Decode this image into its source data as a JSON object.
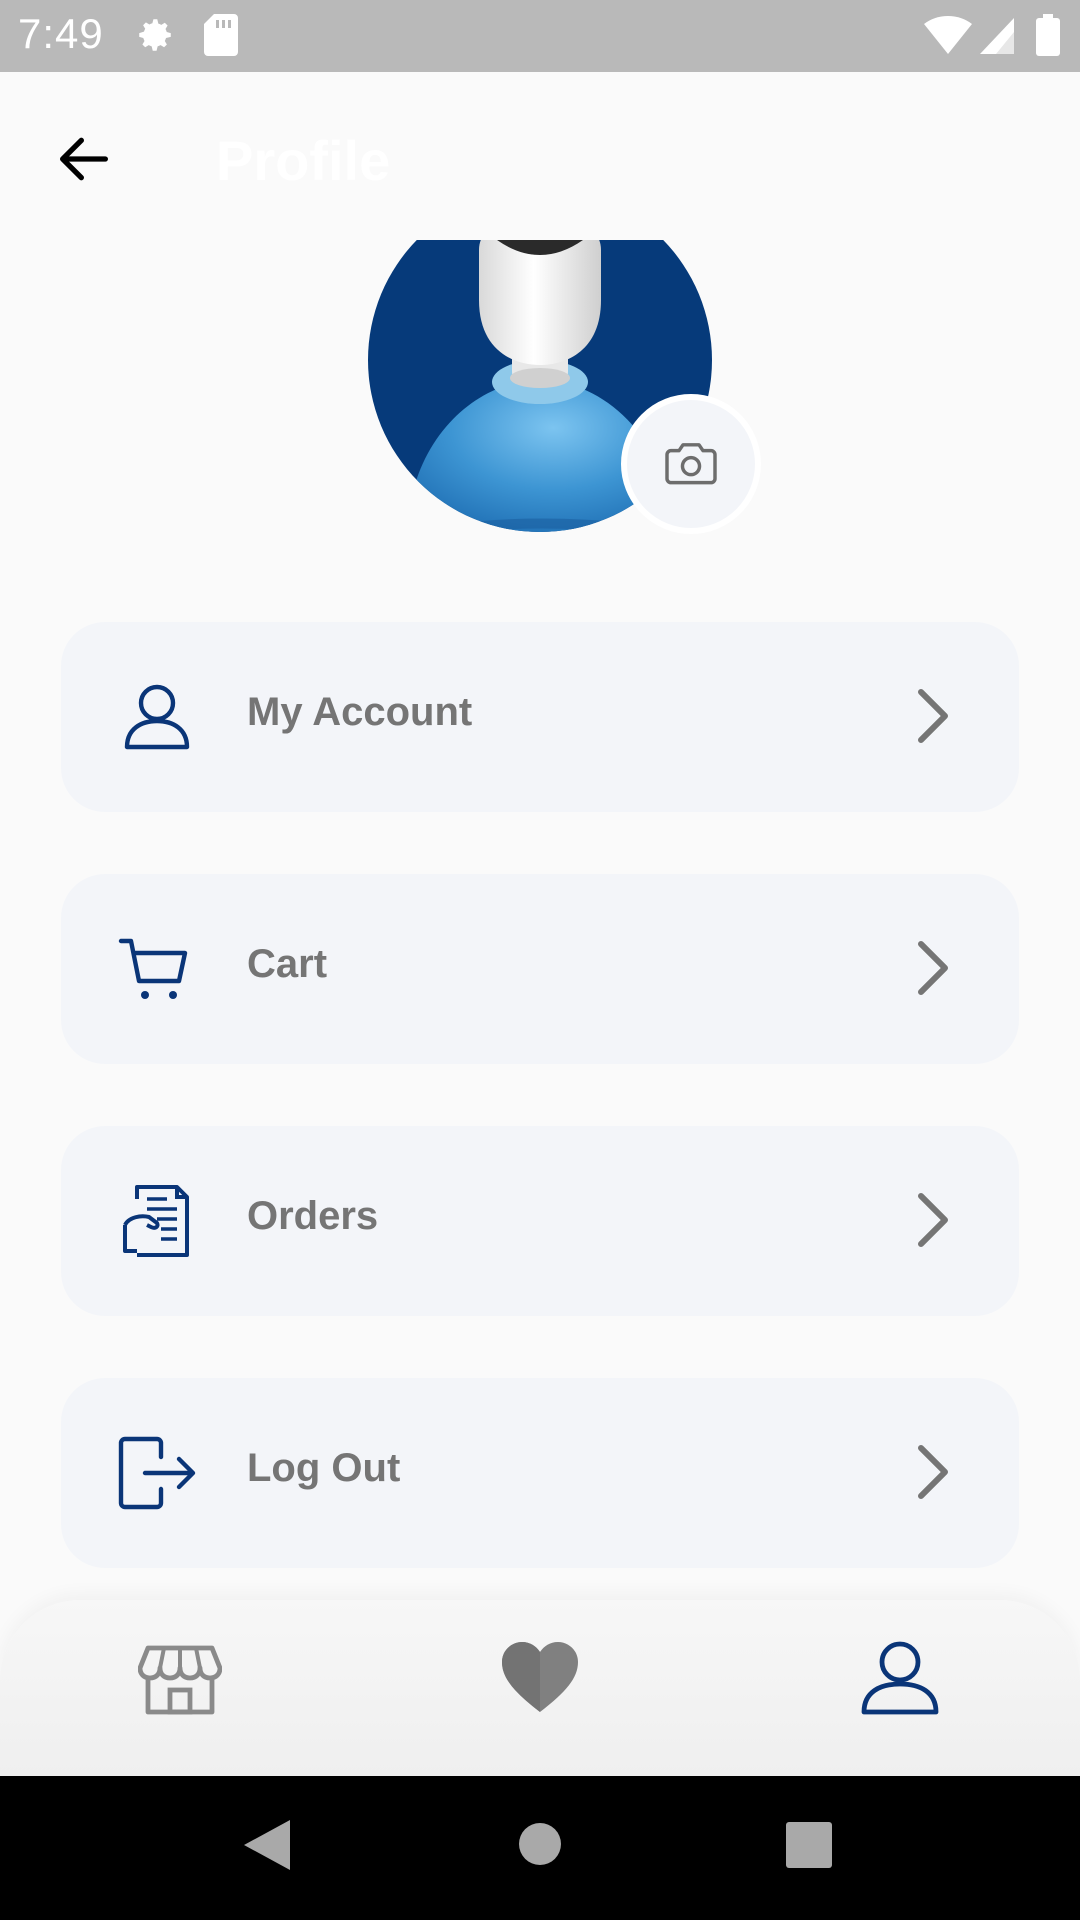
{
  "status_bar": {
    "time": "7:49",
    "icons": [
      "gear-icon",
      "sd-card-icon",
      "wifi-icon",
      "signal-icon",
      "battery-icon"
    ]
  },
  "app_bar": {
    "title": "Profile",
    "back_icon": "arrow-left-icon"
  },
  "profile": {
    "avatar": "default-user-avatar",
    "camera_icon": "camera-icon"
  },
  "menu": {
    "items": [
      {
        "label": "My Account",
        "icon": "user-icon"
      },
      {
        "label": "Cart",
        "icon": "cart-icon"
      },
      {
        "label": "Orders",
        "icon": "receipt-icon"
      },
      {
        "label": "Log Out",
        "icon": "logout-icon"
      }
    ]
  },
  "bottom_nav": {
    "items": [
      {
        "icon": "shop-icon",
        "active": false
      },
      {
        "icon": "heart-icon",
        "active": false
      },
      {
        "icon": "user-icon",
        "active": true
      }
    ]
  },
  "colors": {
    "accent": "#0a3578",
    "card_bg": "#f3f5f9",
    "label": "#757575",
    "inactive_icon": "#8a8a8a",
    "status_bar": "#b9b9b9"
  }
}
